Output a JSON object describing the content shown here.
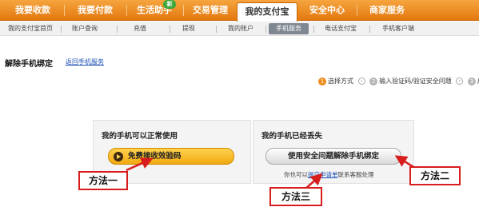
{
  "topnav": {
    "tabs": [
      {
        "label": "我要收款"
      },
      {
        "label": "我要付款"
      },
      {
        "label": "生活助手"
      },
      {
        "label": "交易管理"
      },
      {
        "label": "我的支付宝"
      },
      {
        "label": "安全中心"
      },
      {
        "label": "商家服务"
      }
    ],
    "badge": "新"
  },
  "subnav": {
    "items": [
      {
        "label": "我的支付宝首页"
      },
      {
        "label": "账户查询"
      },
      {
        "label": "充值"
      },
      {
        "label": "提现"
      },
      {
        "label": "我的账户"
      },
      {
        "label": "手机服务"
      },
      {
        "label": "电话支付宝"
      },
      {
        "label": "手机客户端"
      }
    ]
  },
  "page": {
    "title": "解除手机绑定",
    "back_link": "返回手机服务"
  },
  "steps": {
    "items": [
      {
        "num": "1",
        "label": "选择方式"
      },
      {
        "num": "2",
        "label": "输入验证码/验证安全问题"
      },
      {
        "num": "3",
        "label": "成功"
      }
    ]
  },
  "left_panel": {
    "heading": "我的手机可以正常使用",
    "button": "免费接收效验码"
  },
  "right_panel": {
    "heading": "我的手机已经丢失",
    "button": "使用安全问题解除手机绑定",
    "alt_prefix": "你也可以",
    "alt_link": "提交申请单",
    "alt_suffix": "联系客服处理"
  },
  "annotations": {
    "method1": "方法一",
    "method2": "方法二",
    "method3": "方法三"
  },
  "colors": {
    "nav_orange": "#f08c1c",
    "callout_red": "#d81d1d",
    "link_blue": "#1a4fb5"
  }
}
